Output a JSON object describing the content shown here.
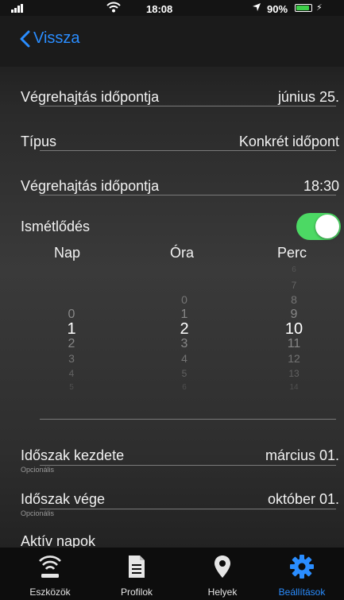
{
  "status_bar": {
    "time": "18:08",
    "battery": "90%",
    "battery_level": 0.9
  },
  "nav": {
    "back_label": "Vissza"
  },
  "rows": {
    "execution_date": {
      "label": "Végrehajtás időpontja",
      "value": "június 25."
    },
    "type": {
      "label": "Típus",
      "value": "Konkrét időpont"
    },
    "execution_time": {
      "label": "Végrehajtás időpontja",
      "value": "18:30"
    },
    "repeat": {
      "label": "Ismétlődés",
      "enabled": true
    },
    "period_start": {
      "label": "Időszak kezdete",
      "sub": "Opcionális",
      "value": "március 01."
    },
    "period_end": {
      "label": "Időszak vége",
      "sub": "Opcionális",
      "value": "október 01."
    },
    "active_days": {
      "label": "Aktív napok"
    }
  },
  "picker": {
    "headers": [
      "Nap",
      "Óra",
      "Perc"
    ],
    "columns": [
      {
        "items": [
          "0",
          "1",
          "2",
          "3",
          "4",
          "5"
        ],
        "selected": "1"
      },
      {
        "items": [
          "0",
          "1",
          "2",
          "3",
          "4",
          "5",
          "6"
        ],
        "selected": "2"
      },
      {
        "items": [
          "6",
          "7",
          "8",
          "9",
          "10",
          "11",
          "12",
          "13",
          "14"
        ],
        "selected": "10"
      }
    ]
  },
  "tabs": [
    {
      "label": "Eszközök",
      "icon": "wifi-icon"
    },
    {
      "label": "Profilok",
      "icon": "document-icon"
    },
    {
      "label": "Helyek",
      "icon": "location-pin-icon"
    },
    {
      "label": "Beállítások",
      "icon": "gear-icon",
      "active": true
    }
  ],
  "colors": {
    "accent": "#2a8dff",
    "toggle_on": "#4cd964",
    "battery": "#3ecf4a"
  }
}
